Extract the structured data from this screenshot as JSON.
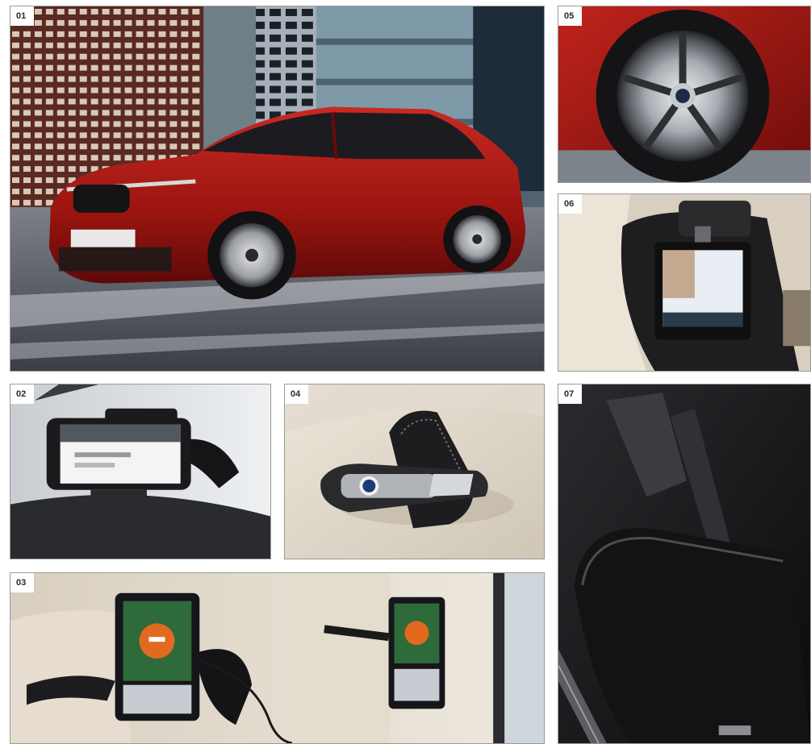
{
  "tiles": [
    {
      "id": "01",
      "subject": "red-suv-coupe-photo"
    },
    {
      "id": "05",
      "subject": "alloy-wheel-photo"
    },
    {
      "id": "06",
      "subject": "tablet-headrest-holder-photo"
    },
    {
      "id": "02",
      "subject": "smartphone-dash-holder-photo"
    },
    {
      "id": "04",
      "subject": "leather-key-case-photo"
    },
    {
      "id": "07",
      "subject": "floor-mat-photo"
    },
    {
      "id": "03",
      "subject": "rear-seat-entertainment-photo"
    }
  ],
  "colors": {
    "tile_border": "#9a9a9a",
    "label_bg": "#ffffff",
    "label_text": "#2a2a2a",
    "car_red": "#a01212"
  }
}
